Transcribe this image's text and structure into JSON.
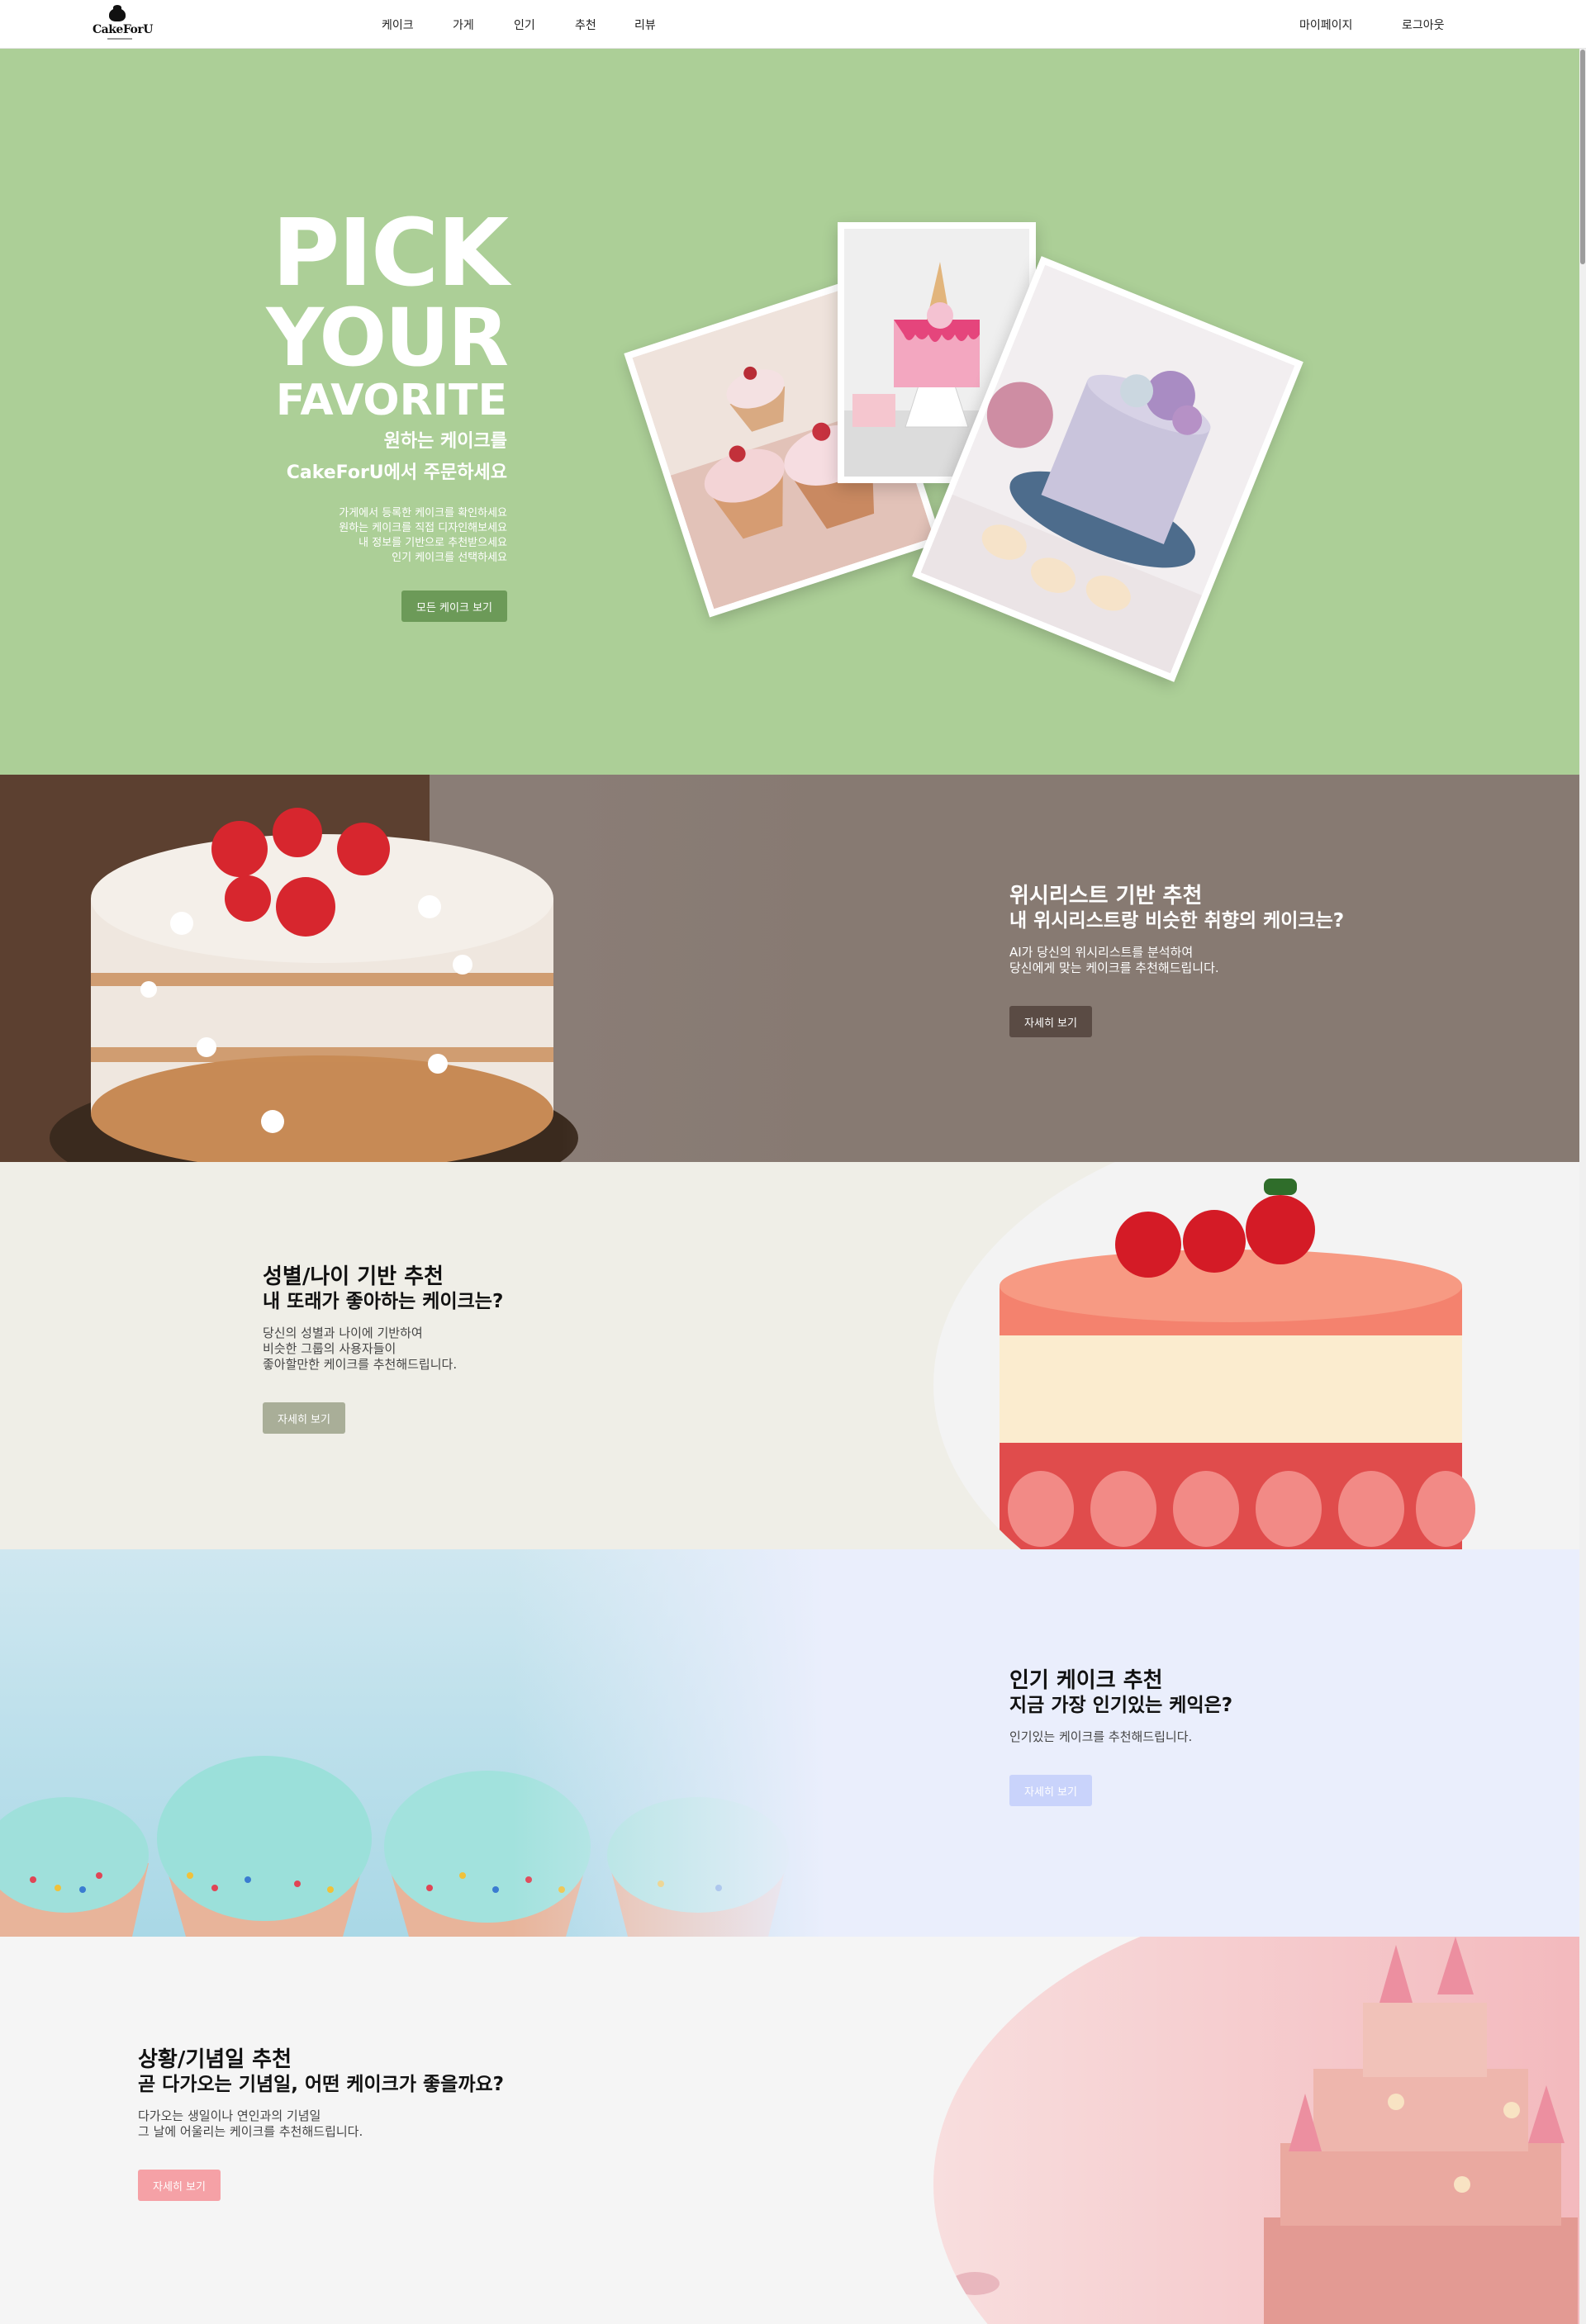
{
  "nav": {
    "logo_text": "CakeForU",
    "menu": [
      "케이크",
      "가게",
      "인기",
      "추천",
      "리뷰"
    ],
    "mypage": "마이페이지",
    "logout": "로그아웃"
  },
  "hero": {
    "title_line1": "PICK",
    "title_line2": "YOUR",
    "title_line3": "FAVORITE",
    "sub_line1": "원하는 케이크를",
    "sub_line2": "CakeForU에서 주문하세요",
    "desc": [
      "가게에서 등록한 케이크를 확인하세요",
      "원하는 케이크를 직접 디자인해보세요",
      "내 정보를 기반으로 추천받으세요",
      "인기 케이크를 선택하세요"
    ],
    "button": "모든 케이크 보기"
  },
  "sections": [
    {
      "title": "위시리스트 기반 추천",
      "subtitle": "내 위시리스트랑 비슷한 취향의 케이크는?",
      "desc": [
        "AI가 당신의 위시리스트를 분석하여",
        "당신에게 맞는 케이크를 추천해드립니다."
      ],
      "button": "자세히 보기"
    },
    {
      "title": "성별/나이 기반 추천",
      "subtitle": "내 또래가 좋아하는 케이크는?",
      "desc": [
        "당신의 성별과 나이에 기반하여",
        "비슷한 그룹의 사용자들이",
        "좋아할만한 케이크를 추천해드립니다."
      ],
      "button": "자세히 보기"
    },
    {
      "title": "인기 케이크 추천",
      "subtitle": "지금 가장 인기있는 케익은?",
      "desc": [
        "인기있는 케이크를 추천해드립니다."
      ],
      "button": "자세히 보기"
    },
    {
      "title": "상황/기념일 추천",
      "subtitle": "곧 다가오는 기념일, 어떤 케이크가 좋을까요?",
      "desc": [
        "다가오는 생일이나 연인과의 기념일",
        "그 날에 어울리는 케이크를 추천해드립니다."
      ],
      "button": "자세히 보기"
    }
  ],
  "colors": {
    "hero_bg": "#accf97",
    "hero_button": "#6c9a58",
    "section1_bg": "#877a72",
    "section1_button": "#5a4b44",
    "section2_bg": "#efeee7",
    "section2_button": "#a9ae98",
    "section3_bg": "#eaeefc",
    "section3_button": "#c9d3fb",
    "section4_bg": "#f5f5f5",
    "section4_button": "#f5a1a6"
  }
}
